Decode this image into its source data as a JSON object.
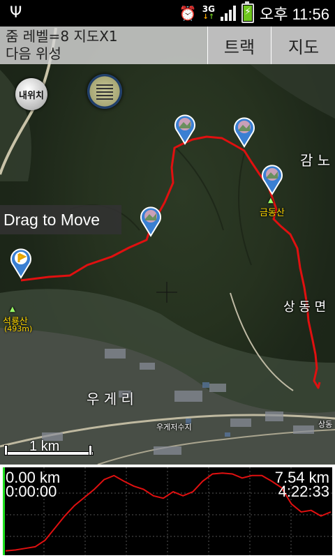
{
  "status_bar": {
    "usb_icon": "usb-icon",
    "alarm_icon": "alarm-clock-icon",
    "network": "3G",
    "signal_icon": "signal-bars-icon",
    "battery_icon": "battery-charging-icon",
    "time": "오후 11:56"
  },
  "header": {
    "zoom_line": "줌 레벨=8 지도X1",
    "next_line": "다음 위성",
    "track_button": "트랙",
    "map_button": "지도"
  },
  "map": {
    "my_location_button": "내위치",
    "drag_tip": "Drag to Move",
    "scale_label": "1 km",
    "places": {
      "geumdongsan": "금동산",
      "seokryongsan": "석룡산",
      "seokryongsan_elev": "(493m)",
      "sangdongmyeon": "상 동 면",
      "gamno": "감 노",
      "ugyeri": "우 게 리",
      "ugye_reservoir": "우게저수지",
      "sangdong": "상동"
    },
    "accent_track_color": "#e01010"
  },
  "elevation_panel": {
    "start_distance": "0.00 km",
    "start_time": "0:00:00",
    "total_distance": "7.54 km",
    "total_time": "4:22:33",
    "profile": [
      0.98,
      0.97,
      0.95,
      0.93,
      0.85,
      0.7,
      0.55,
      0.42,
      0.32,
      0.22,
      0.1,
      0.05,
      0.12,
      0.18,
      0.22,
      0.3,
      0.33,
      0.25,
      0.3,
      0.25,
      0.12,
      0.03,
      0.02,
      0.03,
      0.08,
      0.05,
      0.05,
      0.12,
      0.2,
      0.4,
      0.5,
      0.48,
      0.55,
      0.5
    ]
  }
}
